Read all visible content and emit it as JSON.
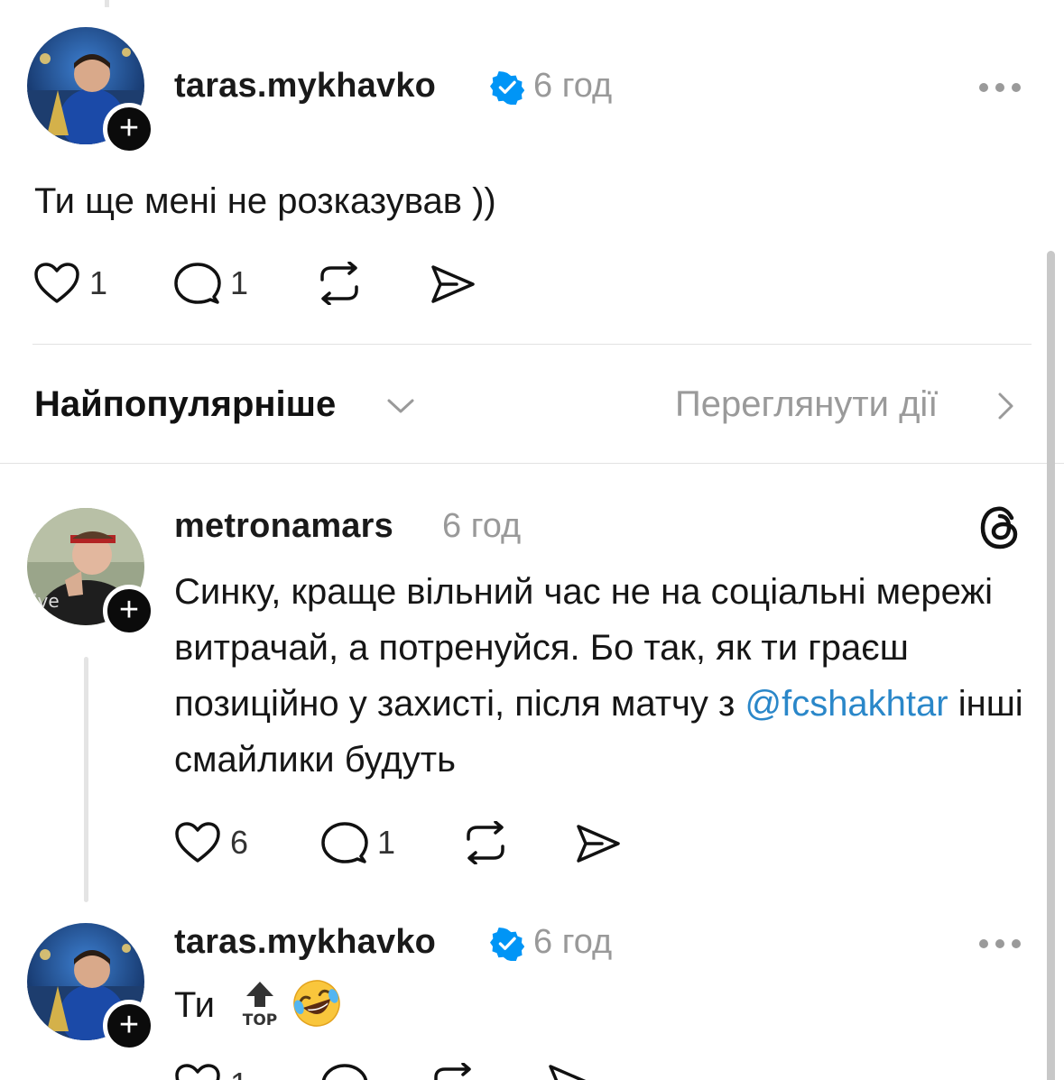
{
  "post": {
    "username": "taras.mykhavko",
    "time": "6 год",
    "text": "Ти ще мені не розказував ))",
    "likes": "1",
    "replies": "1"
  },
  "sort": {
    "label": "Найпопулярніше",
    "activity_link": "Переглянути дії"
  },
  "comments": [
    {
      "username": "metronamars",
      "time": "6 год",
      "text_before": "Синку, краще вільний час не на соціальні мережі витрачай, а потренуйся. Бо так, як ти граєш позиційно у захисті, після матчу з ",
      "mention": "@fcshakhtar",
      "text_after": " інші смайлики будуть",
      "likes": "6",
      "replies": "1"
    },
    {
      "username": "taras.mykhavko",
      "time": "6 год",
      "text": "Ти",
      "likes": "1"
    }
  ],
  "colors": {
    "verified": "#0095f6",
    "mention": "#2a87c9",
    "muted": "#999999"
  },
  "icons": [
    "heart-icon",
    "comment-icon",
    "repost-icon",
    "share-icon",
    "verified-icon",
    "more-icon",
    "threads-logo-icon",
    "chevron-down-icon",
    "chevron-right-icon",
    "plus-icon",
    "top-arrow-emoji",
    "laughing-emoji"
  ]
}
